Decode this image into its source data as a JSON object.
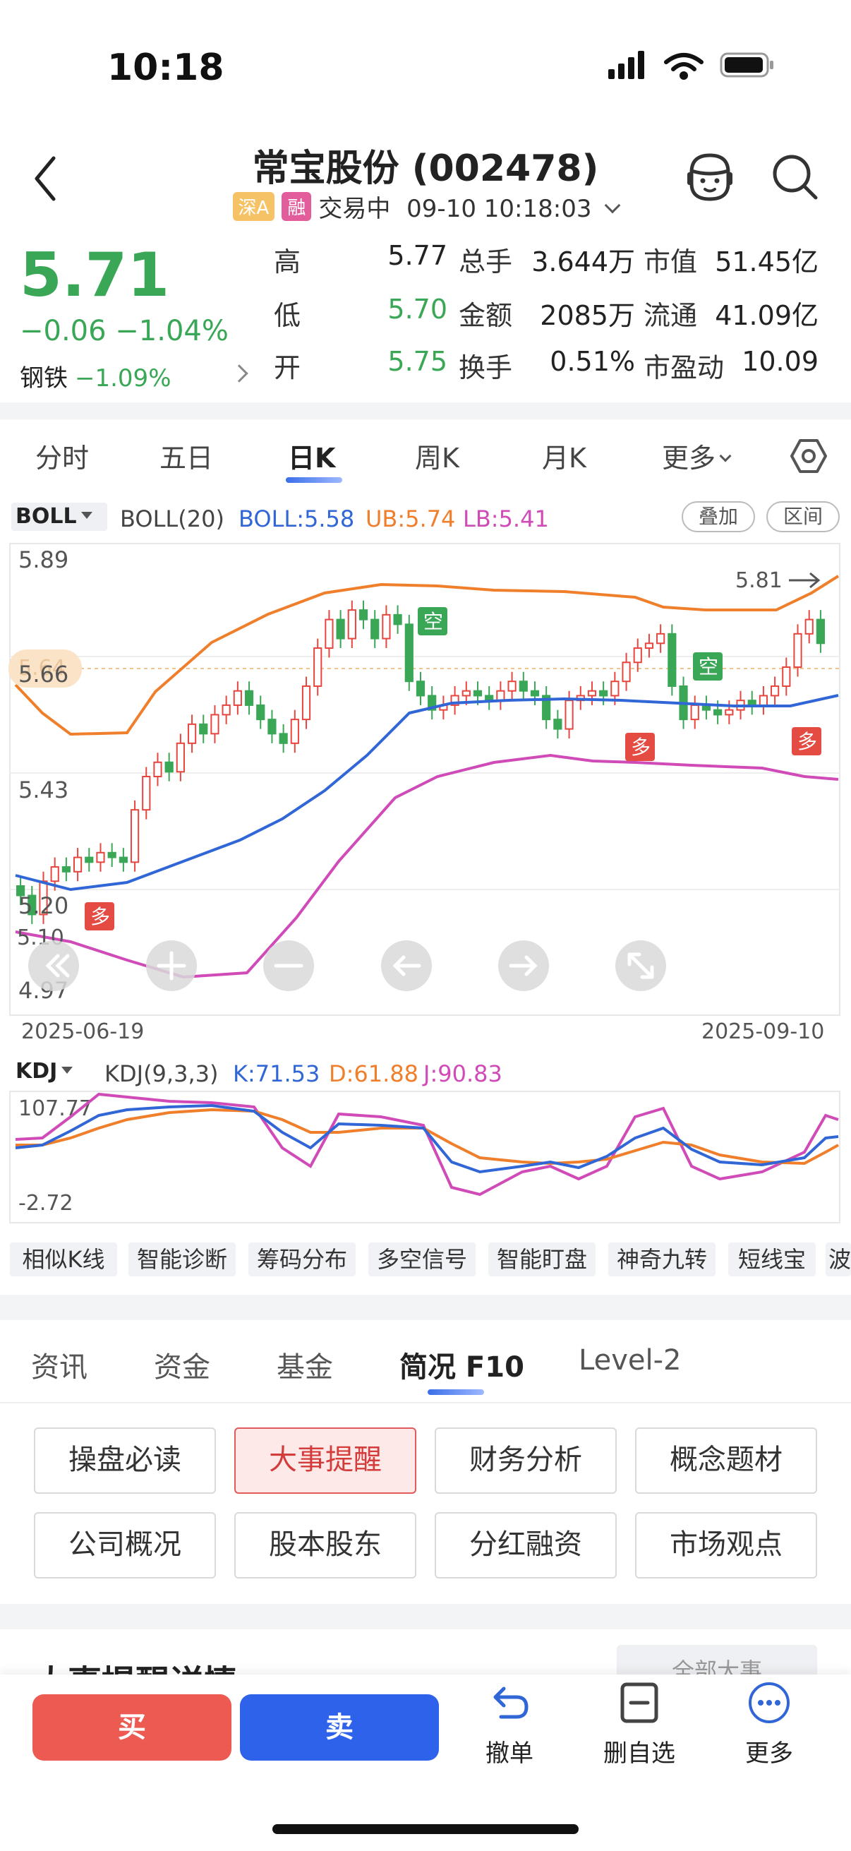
{
  "status": {
    "time": "10:18"
  },
  "header": {
    "title": "常宝股份 (002478)",
    "badge_a": "深A",
    "badge_rong": "融",
    "trade_state": "交易中",
    "datetime": "09-10 10:18:03"
  },
  "quote": {
    "price": "5.71",
    "change": "−0.06 −1.04%",
    "sector_name": "钢铁",
    "sector_pct": "−1.09%",
    "stats": [
      {
        "l1": "高",
        "v1": "5.77",
        "l2": "总手",
        "v2": "3.644万",
        "l3": "市值",
        "v3": "51.45亿"
      },
      {
        "l1": "低",
        "v1": "5.70",
        "l2": "金额",
        "v2": "2085万",
        "l3": "流通",
        "v3": "41.09亿"
      },
      {
        "l1": "开",
        "v1": "5.75",
        "l2": "换手",
        "v2": "0.51%",
        "l3": "市盈动",
        "v3": "10.09"
      }
    ]
  },
  "tabs": [
    "分时",
    "五日",
    "日K",
    "周K",
    "月K",
    "更多"
  ],
  "boll": {
    "label": "BOLL",
    "params": "BOLL(20)",
    "mid": "BOLL:5.58",
    "ub": "UB:5.74",
    "lb": "LB:5.41",
    "btn_overlay": "叠加",
    "btn_range": "区间"
  },
  "main_chart": {
    "y_labels": [
      "5.89",
      "5.66",
      "5.43",
      "5.20",
      "4.97"
    ],
    "price_tag": "5.64",
    "low_marker": "5.10",
    "high_marker": "5.81",
    "signal_duo": "多",
    "signal_kong": "空",
    "date_start": "2025-06-19",
    "date_end": "2025-09-10"
  },
  "kdj": {
    "label": "KDJ",
    "params": "KDJ(9,3,3)",
    "k": "K:71.53",
    "d": "D:61.88",
    "j": "J:90.83",
    "top": "107.77",
    "bottom": "-2.72"
  },
  "tools": [
    "相似K线",
    "智能诊断",
    "筹码分布",
    "多空信号",
    "智能盯盘",
    "神奇九转",
    "短线宝",
    "波"
  ],
  "info_tabs": [
    "资讯",
    "资金",
    "基金",
    "简况 F10",
    "Level-2"
  ],
  "f10_buttons": [
    "操盘必读",
    "大事提醒",
    "财务分析",
    "概念题材",
    "公司概况",
    "股本股东",
    "分红融资",
    "市场观点"
  ],
  "peek": {
    "title": "大事提醒详情",
    "filter": "全部大事"
  },
  "bottom": {
    "buy": "买",
    "sell": "卖",
    "cancel": "撤单",
    "remove_watch": "删自选",
    "more": "更多"
  },
  "colors": {
    "up": "#e7463f",
    "down": "#3aa757",
    "mid": "#3166d6",
    "ub": "#f07f2c",
    "lb": "#d04bb8"
  }
}
